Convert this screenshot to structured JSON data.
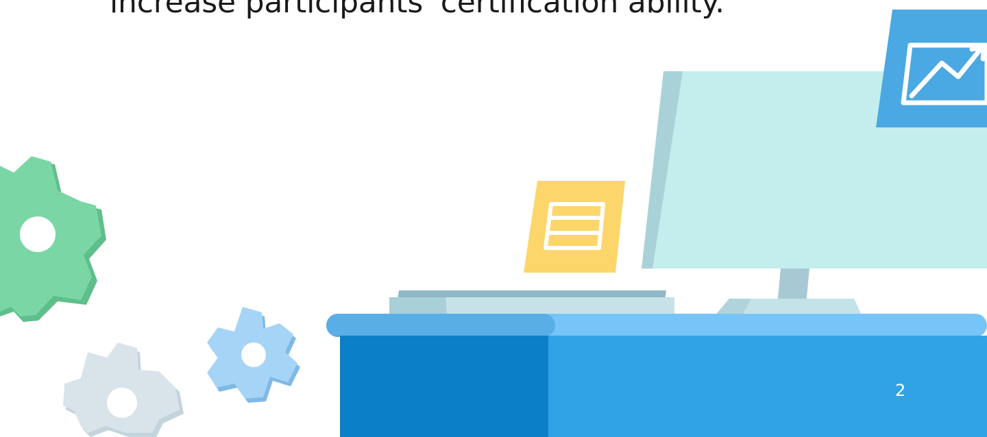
{
  "slide": {
    "body_text": "increase participants' certification ability.",
    "page_number": "2"
  },
  "colors": {
    "background": "#ffffff",
    "text": "#1a1a1a",
    "gear_green": "#7ad6a5",
    "gear_blue": "#9fd0f5",
    "gear_gray": "#d6e2e8",
    "desk_top": "#77c5f8",
    "desk_front_dark": "#0b7fc7",
    "desk_front_light": "#30a3e6",
    "monitor_screen": "#c4eded",
    "note_yellow": "#fcd66a",
    "chart_card": "#4aa8e2"
  },
  "icons": {
    "gear_1": "gear-icon",
    "gear_2": "gear-icon",
    "gear_3": "gear-icon",
    "document": "document-icon",
    "chart": "trend-chart-icon"
  }
}
